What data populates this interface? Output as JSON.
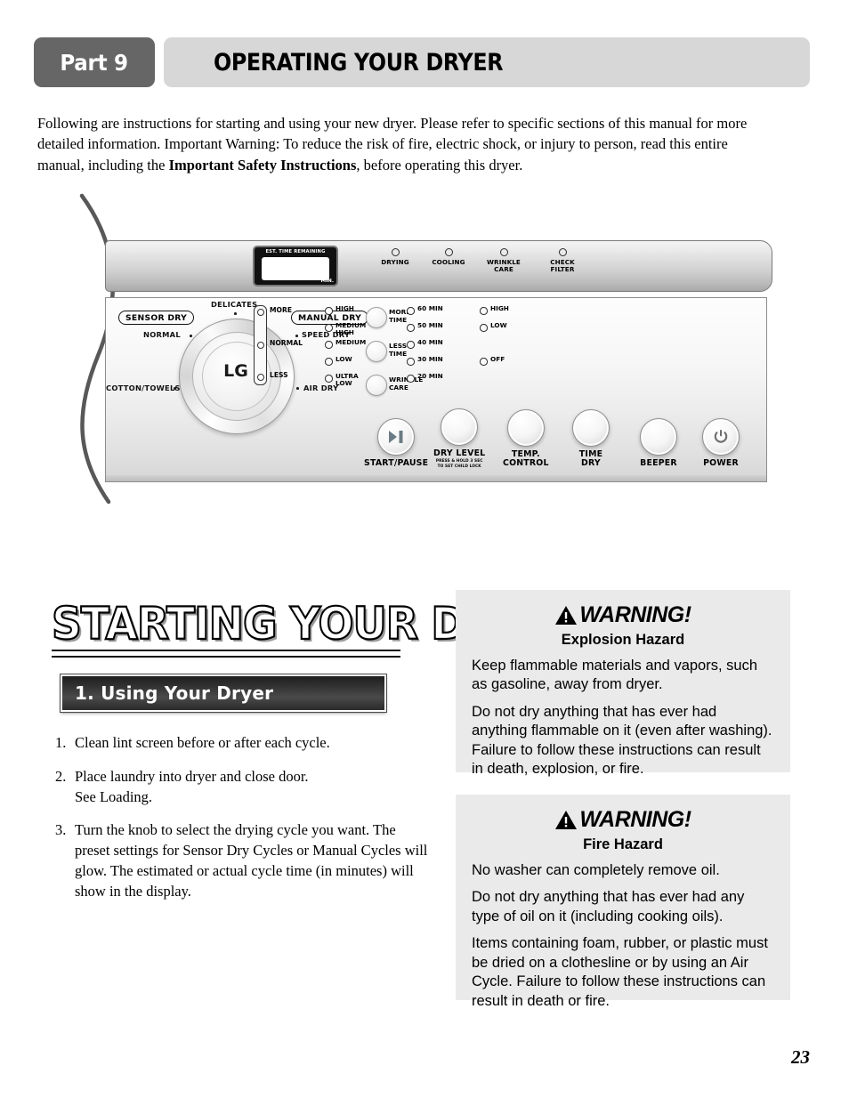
{
  "header": {
    "part_label": "Part 9",
    "title": "OPERATING YOUR DRYER"
  },
  "intro": {
    "text_before": "Following are instructions for starting and using your new dryer.  Please refer to specific sections of this manual for more detailed information.  Important Warning:  To reduce the risk of fire, electric shock, or injury to person, read this entire manual, including the ",
    "bold_phrase": "Important Safety Instructions",
    "text_after": ", before operating this dryer."
  },
  "control_panel": {
    "display": {
      "label": "EST. TIME REMAINING",
      "unit": "MIN.",
      "value": ""
    },
    "status_leds": [
      {
        "label": "DRYING"
      },
      {
        "label": "COOLING"
      },
      {
        "label": "WRINKLE\nCARE"
      },
      {
        "label": "CHECK\nFILTER"
      }
    ],
    "mode_boxes": {
      "sensor": "SENSOR DRY",
      "manual": "MANUAL DRY"
    },
    "knob": {
      "brand": "LG",
      "cycles": [
        {
          "label": "DELICATES"
        },
        {
          "label": "NORMAL"
        },
        {
          "label": "COTTON/TOWELS"
        },
        {
          "label": "SPEED DRY"
        },
        {
          "label": "AIR DRY"
        }
      ]
    },
    "option_buttons": [
      {
        "label": "MORE\nTIME"
      },
      {
        "label": "LESS\nTIME"
      },
      {
        "label": "WRINKLE\nCARE"
      }
    ],
    "dry_level_scale": [
      {
        "label": "MORE"
      },
      {
        "label": "NORMAL"
      },
      {
        "label": "LESS"
      }
    ],
    "temp_control_options": [
      {
        "label": "HIGH"
      },
      {
        "label": "MEDIUM\nHIGH"
      },
      {
        "label": "MEDIUM"
      },
      {
        "label": "LOW"
      },
      {
        "label": "ULTRA\nLOW"
      }
    ],
    "time_dry_options": [
      {
        "label": "60 MIN"
      },
      {
        "label": "50 MIN"
      },
      {
        "label": "40 MIN"
      },
      {
        "label": "30 MIN"
      },
      {
        "label": "20 MIN"
      }
    ],
    "beeper_options": [
      {
        "label": "HIGH"
      },
      {
        "label": "LOW"
      },
      {
        "label": "OFF"
      }
    ],
    "main_buttons": [
      {
        "label": "START/PAUSE",
        "sub": "",
        "icon": "play-pause-icon"
      },
      {
        "label": "DRY LEVEL",
        "sub": "PRESS & HOLD 3 SEC\nTO SET CHILD LOCK",
        "icon": ""
      },
      {
        "label": "TEMP.\nCONTROL",
        "sub": "",
        "icon": ""
      },
      {
        "label": "TIME\nDRY",
        "sub": "",
        "icon": ""
      },
      {
        "label": "BEEPER",
        "sub": "",
        "icon": ""
      },
      {
        "label": "POWER",
        "sub": "",
        "icon": "power-icon"
      }
    ]
  },
  "section": {
    "heading": "STARTING YOUR DRYER",
    "subsection_bar": "1. Using Your Dryer",
    "steps": [
      {
        "num": "1.",
        "text": "Clean lint screen before or after each cycle."
      },
      {
        "num": "2.",
        "text": "Place laundry into dryer and close door.\nSee Loading."
      },
      {
        "num": "3.",
        "text": "Turn the knob to select the drying cycle you want. The preset settings for Sensor Dry Cycles or Manual Cycles will glow. The estimated or actual cycle time (in minutes) will show in the display."
      }
    ]
  },
  "warnings": [
    {
      "title": "WARNING!",
      "hazard": "Explosion Hazard",
      "paragraphs": [
        "Keep flammable materials and vapors, such as gasoline, away from dryer.",
        "Do not dry anything that has ever had anything flammable on it (even after washing). Failure to follow these instructions can result in death, explosion, or fire."
      ]
    },
    {
      "title": "WARNING!",
      "hazard": "Fire Hazard",
      "paragraphs": [
        "No washer can completely remove oil.",
        "Do not dry anything that has ever had any type of oil on it (including cooking oils).",
        "Items containing foam, rubber, or plastic  must be dried on a clothesline or by using an Air Cycle. Failure to follow these instructions can result in death or fire."
      ]
    }
  ],
  "page_number": "23"
}
